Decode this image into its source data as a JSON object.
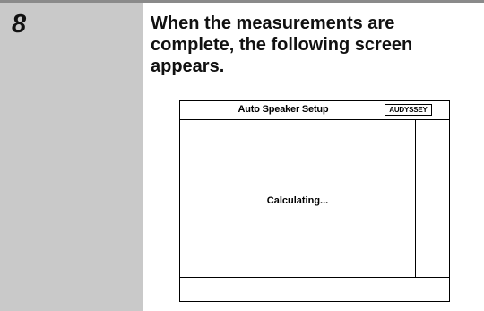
{
  "step": {
    "number": "8",
    "instruction": "When the measurements are complete, the following screen appears."
  },
  "screen": {
    "title": "Auto Speaker Setup",
    "badge": "AUDYSSEY",
    "message": "Calculating..."
  }
}
